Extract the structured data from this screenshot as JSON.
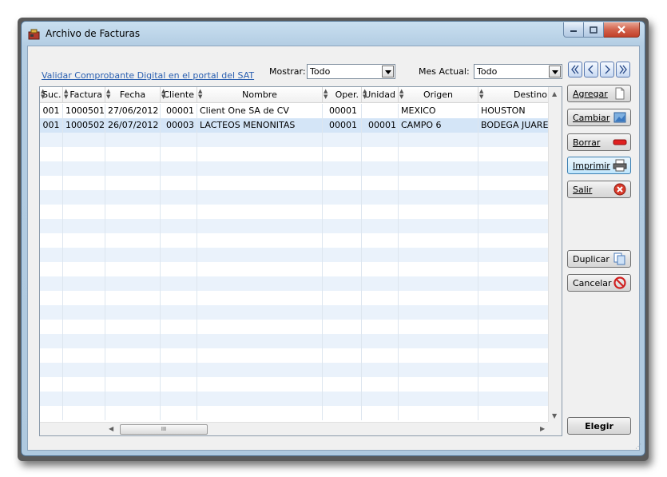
{
  "window": {
    "title": "Archivo de Facturas"
  },
  "toolbar": {
    "sat_link": "Validar Comprobante Digital en el portal del SAT",
    "mostrar_label": "Mostrar:",
    "mostrar_value": "Todo",
    "mes_label": "Mes Actual:",
    "mes_value": "Todo"
  },
  "nav_icons": [
    "first-page-icon",
    "previous-page-icon",
    "next-page-icon",
    "last-page-icon"
  ],
  "table": {
    "columns": [
      "Suc.",
      "Factura",
      "Fecha",
      "Cliente",
      "Nombre",
      "Oper.",
      "Unidad",
      "Origen",
      "Destino"
    ],
    "rows": [
      [
        "001",
        "1000501",
        "27/06/2012",
        "00001",
        "Client One SA de CV",
        "00001",
        "",
        "MEXICO",
        "HOUSTON"
      ],
      [
        "001",
        "1000502",
        "26/07/2012",
        "00003",
        "LACTEOS MENONITAS",
        "00001",
        "00001",
        "CAMPO 6",
        "BODEGA JUAREZ"
      ]
    ],
    "selected_row": 1,
    "hscroll_grip": "III"
  },
  "buttons": {
    "agregar": "Agregar",
    "cambiar": "Cambiar",
    "borrar": "Borrar",
    "imprimir": "Imprimir",
    "salir": "Salir",
    "duplicar": "Duplicar",
    "cancelar": "Cancelar",
    "elegir": "Elegir"
  },
  "colors": {
    "title_bar": "#b3cde3",
    "close_button": "#c2412a",
    "selected_row": "#d4e5f7",
    "alt_row": "#eaf2fb",
    "link": "#2a5fb0"
  }
}
